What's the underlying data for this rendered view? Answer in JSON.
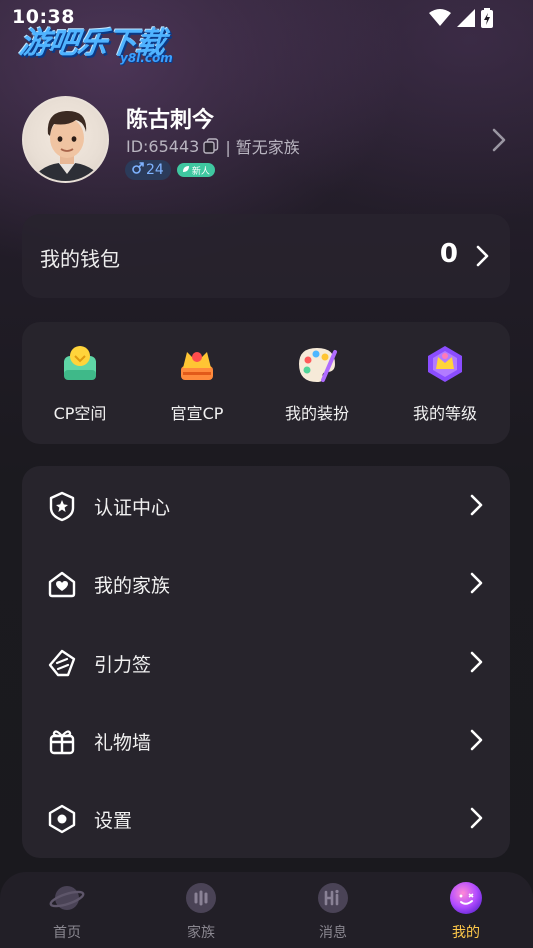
{
  "status_bar": {
    "time": "10:38"
  },
  "watermark": {
    "main": "游吧乐下载",
    "sub": "y8l.com"
  },
  "profile": {
    "name": "陈古刺今",
    "id_text": "ID:65443",
    "family_text": "| 暂无家族",
    "gender_age": "24",
    "new_badge": "新人"
  },
  "wallet": {
    "label": "我的钱包",
    "value": "0"
  },
  "features": [
    {
      "label": "CP空间",
      "icon": "cp-space-icon"
    },
    {
      "label": "官宣CP",
      "icon": "crown-icon"
    },
    {
      "label": "我的装扮",
      "icon": "palette-icon"
    },
    {
      "label": "我的等级",
      "icon": "level-crown-icon"
    }
  ],
  "menu": [
    {
      "label": "认证中心",
      "icon": "shield-star-icon"
    },
    {
      "label": "我的家族",
      "icon": "home-heart-icon"
    },
    {
      "label": "引力签",
      "icon": "tag-icon"
    },
    {
      "label": "礼物墙",
      "icon": "gift-icon"
    },
    {
      "label": "设置",
      "icon": "hexagon-settings-icon"
    }
  ],
  "bottom_nav": [
    {
      "label": "首页",
      "icon": "planet-icon"
    },
    {
      "label": "家族",
      "icon": "family-icon"
    },
    {
      "label": "消息",
      "icon": "message-hi-icon"
    },
    {
      "label": "我的",
      "icon": "profile-face-icon",
      "active": true
    }
  ],
  "colors": {
    "accent": "#ffc94a",
    "background": "#1a191e",
    "card": "#27242c"
  }
}
